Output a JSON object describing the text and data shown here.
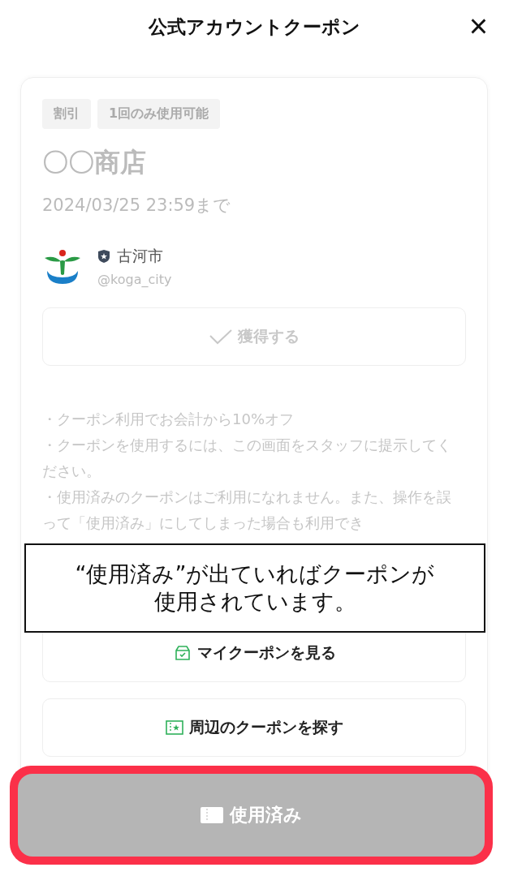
{
  "header": {
    "title": "公式アカウントクーポン",
    "close": "×"
  },
  "coupon": {
    "tags": [
      "割引",
      "1回のみ使用可能"
    ],
    "shop": "〇〇商店",
    "expiry": "2024/03/25 23:59まで",
    "account": {
      "name": "古河市",
      "handle": "@koga_city",
      "verified": true
    },
    "get_button": {
      "label": "獲得する",
      "disabled": true
    },
    "description": [
      "・クーポン利用でお会計から10%オフ",
      "・クーポンを使用するには、この画面をスタッフに提示してください。",
      "・使用済みのクーポンはご利用になれません。また、操作を誤って「使用済み」にしてしまった場合も利用でき"
    ],
    "links": [
      {
        "kind": "mycoupons",
        "label": "マイクーポンを見る"
      },
      {
        "kind": "nearby",
        "label": "周辺のクーポンを探す"
      }
    ]
  },
  "used_button": {
    "label": "使用済み",
    "used": true,
    "highlighted": true
  },
  "annotation": {
    "lines": [
      "“使用済み”が出ていればクーポンが",
      "使用されています。"
    ]
  }
}
